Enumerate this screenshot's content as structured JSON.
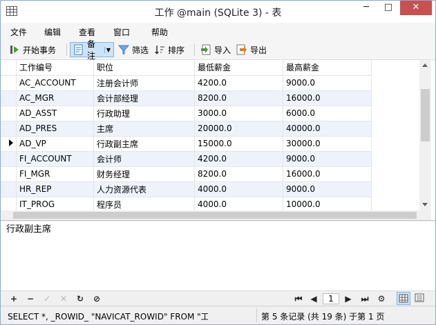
{
  "window": {
    "title": "工作 @main (SQLite 3) - 表",
    "min_glyph": "─",
    "max_glyph": "□",
    "close_glyph": "✕"
  },
  "menu": [
    "文件",
    "编辑",
    "查看",
    "窗口",
    "帮助"
  ],
  "toolbar": {
    "begin_transaction": "开始事务",
    "memo": "备注",
    "filter": "筛选",
    "sort": "排序",
    "import": "导入",
    "export": "导出"
  },
  "table": {
    "columns": [
      "工作编号",
      "职位",
      "最低薪金",
      "最高薪金"
    ],
    "rows": [
      [
        "AC_ACCOUNT",
        "注册会计师",
        "4200.0",
        "9000.0"
      ],
      [
        "AC_MGR",
        "会计部经理",
        "8200.0",
        "16000.0"
      ],
      [
        "AD_ASST",
        "行政助理",
        "3000.0",
        "6000.0"
      ],
      [
        "AD_PRES",
        "主席",
        "20000.0",
        "40000.0"
      ],
      [
        "AD_VP",
        "行政副主席",
        "15000.0",
        "30000.0"
      ],
      [
        "FI_ACCOUNT",
        "会计师",
        "4200.0",
        "9000.0"
      ],
      [
        "FI_MGR",
        "财务经理",
        "8200.0",
        "16000.0"
      ],
      [
        "HR_REP",
        "人力资源代表",
        "4000.0",
        "9000.0"
      ],
      [
        "IT_PROG",
        "程序员",
        "4000.0",
        "10000.0"
      ]
    ],
    "selected_row_index": 4
  },
  "memo_text": "行政副主席",
  "nav": {
    "add": "+",
    "delete": "−",
    "apply": "✓",
    "cancel": "✕",
    "refresh": "↻",
    "stop": "⊘",
    "first": "⏮",
    "prev": "◀",
    "page": "1",
    "next": "▶",
    "last": "⏭",
    "settings": "⚙"
  },
  "status": {
    "sql": "SELECT *, _ROWID_ \"NAVICAT_ROWID\" FROM \"工",
    "record_info": "第 5 条记录 (共 19 条) 于第 1 页"
  },
  "colors": {
    "accent": "#3c78c8",
    "selected_button": "#cde3f7",
    "alt_row": "#eef3fb",
    "close": "#c75050"
  }
}
